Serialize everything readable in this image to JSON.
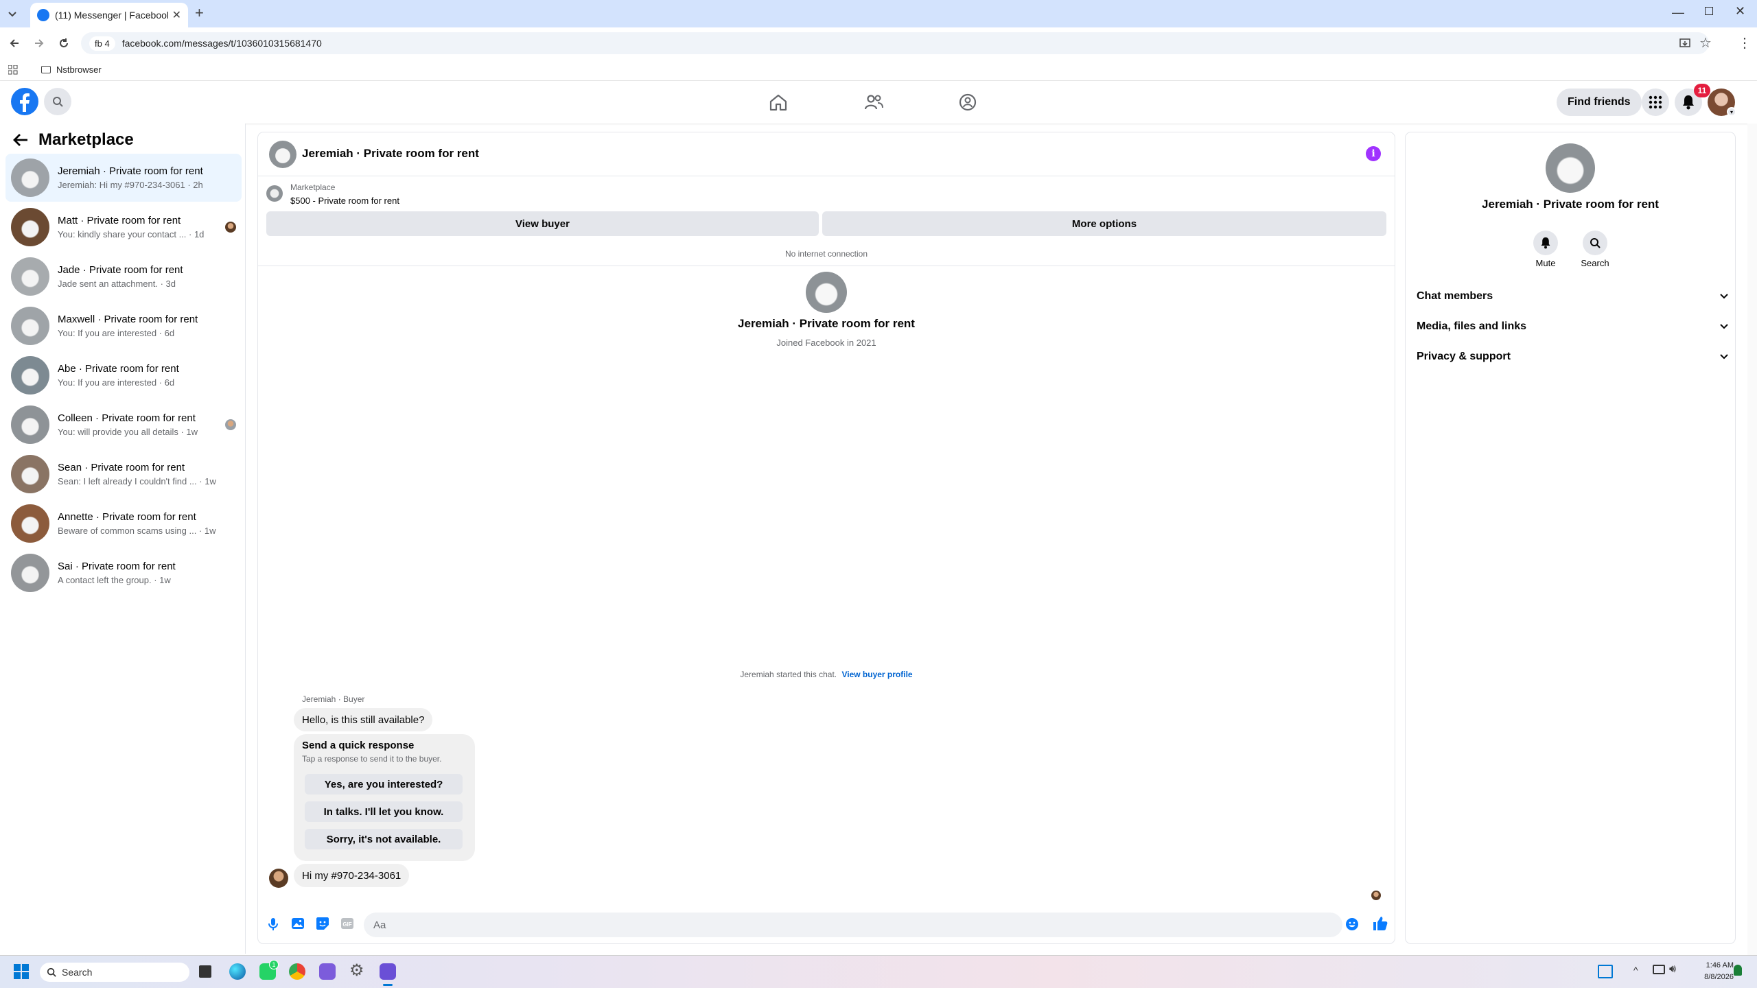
{
  "browser": {
    "tab_title": "(11) Messenger | Facebook",
    "profile_chip": "fb 4",
    "url": "facebook.com/messages/t/10360103156814​70",
    "bookmark_folder": "Nstbrowser"
  },
  "fb_header": {
    "find_friends": "Find friends",
    "notification_count": "11"
  },
  "sidebar": {
    "title": "Marketplace",
    "conversations": [
      {
        "name": "Jeremiah · Private room for rent",
        "preview": "Jeremiah: Hi my #970-234-3061 · 2h",
        "active": true,
        "avatar_color": "#9ea3a8"
      },
      {
        "name": "Matt · Private room for rent",
        "preview": "You: kindly share your contact ... · 1d",
        "avatar_color": "#6b4a32"
      },
      {
        "name": "Jade · Private room for rent",
        "preview": "Jade sent an attachment. · 3d",
        "avatar_color": "#a7abae"
      },
      {
        "name": "Maxwell · Private room for rent",
        "preview": "You: If you are interested · 6d",
        "avatar_color": "#9fa4a8"
      },
      {
        "name": "Abe · Private room for rent",
        "preview": "You: If you are interested · 6d",
        "avatar_color": "#7d8a92"
      },
      {
        "name": "Colleen · Private room for rent",
        "preview": "You: will provide you all details · 1w",
        "avatar_color": "#8e9397"
      },
      {
        "name": "Sean · Private room for rent",
        "preview": "Sean: I left already I couldn't find ... · 1w",
        "avatar_color": "#8a7464"
      },
      {
        "name": "Annette · Private room for rent",
        "preview": "Beware of common scams using ... · 1w",
        "avatar_color": "#8c5b3c"
      },
      {
        "name": "Sai · Private room for rent",
        "preview": "A contact left the group. · 1w",
        "avatar_color": "#939699"
      }
    ]
  },
  "chat": {
    "title": "Jeremiah · Private room for rent",
    "listing_source": "Marketplace",
    "listing_price_title": "$500 - Private room for rent",
    "view_buyer": "View buyer",
    "more_options": "More options",
    "connection_status": "No internet connection",
    "profile_name": "Jeremiah · Private room for rent",
    "joined": "Joined Facebook in 2021",
    "started_text": "Jeremiah started this chat.",
    "view_buyer_profile": "View buyer profile",
    "sender_label": "Jeremiah · Buyer",
    "first_message": "Hello, is this still available?",
    "quick_title": "Send a quick response",
    "quick_subtitle": "Tap a response to send it to the buyer.",
    "quick_responses": [
      "Yes, are you interested?",
      "In talks. I'll let you know.",
      "Sorry, it's not available."
    ],
    "second_message": "Hi my #970-234-3061",
    "composer_placeholder": "Aa"
  },
  "right_panel": {
    "name": "Jeremiah · Private room for rent",
    "mute": "Mute",
    "search": "Search",
    "sections": [
      "Chat members",
      "Media, files and links",
      "Privacy & support"
    ]
  },
  "taskbar": {
    "search_placeholder": "Search",
    "time": "1:46 AM",
    "date": "8/8/2026",
    "whatsapp_badge": "1"
  },
  "colors": {
    "fb_blue": "#1877f2",
    "purple_info": "#a033ff",
    "active_row": "#ebf5ff",
    "badge_red": "#e41e3f"
  }
}
